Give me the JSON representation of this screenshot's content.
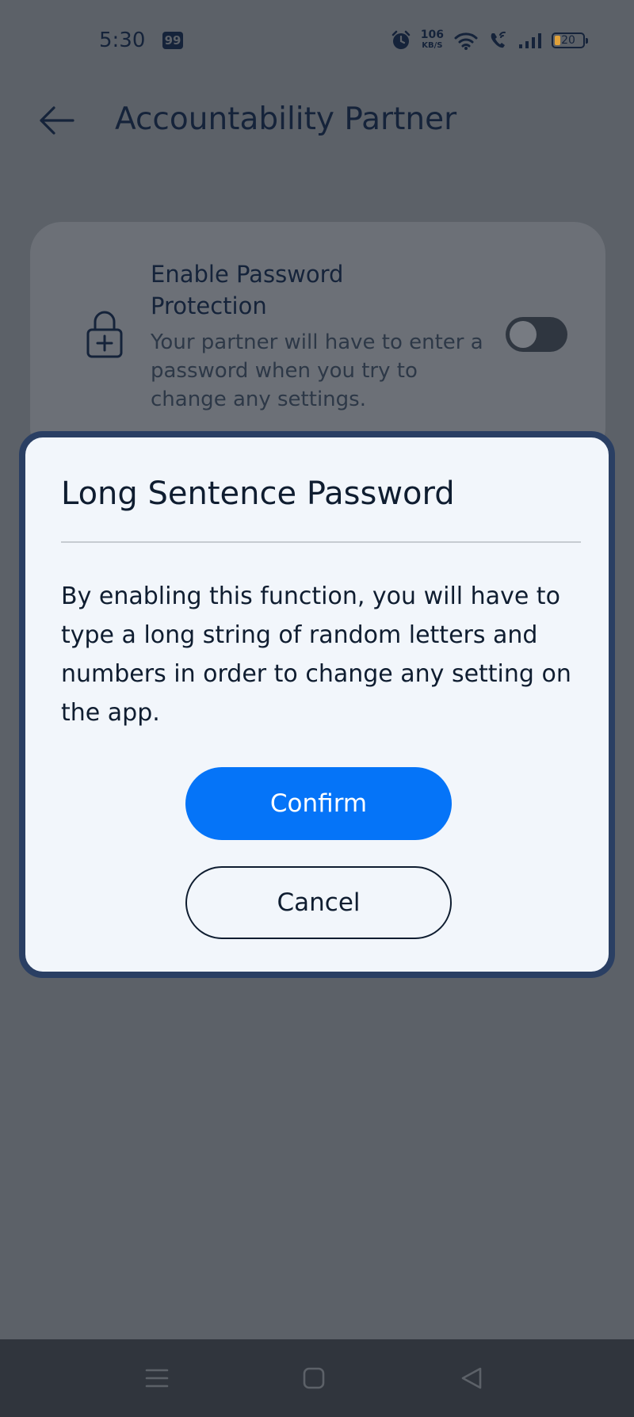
{
  "status_bar": {
    "time": "5:30",
    "notification_badge": "99",
    "net_speed_value": "106",
    "net_speed_unit": "KB/S",
    "battery_level": "20",
    "icons": [
      "alarm-icon",
      "wifi-icon",
      "wifi-call-icon",
      "signal-icon",
      "battery-icon"
    ]
  },
  "header": {
    "back_icon": "arrow-left-icon",
    "title": "Accountability Partner"
  },
  "setting_card": {
    "icon": "lock-plus-icon",
    "title": "Enable Password Protection",
    "description": "Your partner will have to enter a password when you try to change any settings.",
    "toggle_on": false
  },
  "dialog": {
    "title": "Long Sentence Password",
    "body": "By enabling this function, you will have to type a long string of random letters and numbers in order to change any setting on the app.",
    "confirm_label": "Confirm",
    "cancel_label": "Cancel"
  },
  "nav_bar": {
    "icons": [
      "recents-menu-icon",
      "home-icon",
      "back-triangle-icon"
    ]
  },
  "colors": {
    "scrim": "#5c6168",
    "primary": "#0574f8",
    "dialog_border": "#2a3f63",
    "dialog_bg": "#f2f6fb",
    "text_dark": "#0f1d30",
    "battery_fill": "#e0a13a"
  }
}
